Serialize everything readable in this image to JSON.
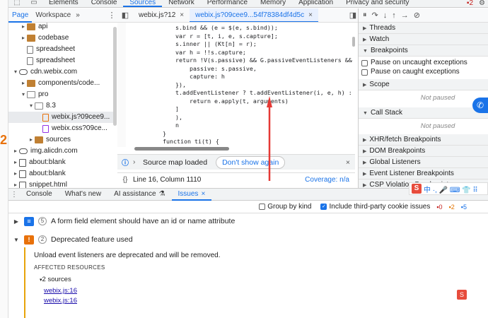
{
  "main_tabs": [
    "Elements",
    "Console",
    "Sources",
    "Network",
    "Performance",
    "Memory",
    "Application",
    "Privacy and security"
  ],
  "main_tabs_active": "Sources",
  "badge_count": "2",
  "navigator": {
    "tabs": [
      "Page",
      "Workspace"
    ],
    "more": "»",
    "items": [
      {
        "label": "api",
        "type": "folder",
        "depth": 2,
        "caret": "▸"
      },
      {
        "label": "codebase",
        "type": "folder",
        "depth": 2,
        "caret": "▸"
      },
      {
        "label": "spreadsheet",
        "type": "file",
        "depth": 2,
        "caret": ""
      },
      {
        "label": "spreadsheet",
        "type": "file",
        "depth": 2,
        "caret": ""
      },
      {
        "label": "cdn.webix.com",
        "type": "cloud",
        "depth": 1,
        "caret": "▾"
      },
      {
        "label": "components/code...",
        "type": "folder",
        "depth": 2,
        "caret": "▸"
      },
      {
        "label": "pro",
        "type": "folder-open",
        "depth": 2,
        "caret": "▾"
      },
      {
        "label": "8.3",
        "type": "folder-open",
        "depth": 3,
        "caret": "▾"
      },
      {
        "label": "webix.js?09cee9...",
        "type": "js",
        "depth": 4,
        "caret": ""
      },
      {
        "label": "webix.css?09ce...",
        "type": "css",
        "depth": 4,
        "caret": ""
      },
      {
        "label": "sources",
        "type": "folder",
        "depth": 3,
        "caret": "▸"
      },
      {
        "label": "img.alicdn.com",
        "type": "cloud",
        "depth": 1,
        "caret": "▸"
      },
      {
        "label": "about:blank",
        "type": "doc",
        "depth": 1,
        "caret": "▸"
      },
      {
        "label": "about:blank",
        "type": "doc",
        "depth": 1,
        "caret": "▸"
      },
      {
        "label": "snippet.html",
        "type": "doc",
        "depth": 1,
        "caret": "▸"
      }
    ]
  },
  "editor": {
    "tabs": [
      {
        "label": "webix.js?12",
        "close": "×",
        "active": false
      },
      {
        "label": "webix.js?09cee9...54f78384df4d5c",
        "close": "×",
        "active": true
      }
    ],
    "code": [
      {
        "text": "s.bind && (e = $(e, s.bind));",
        "indent": 82,
        "kw": false
      },
      {
        "text": "var r = [t, i, e, s.capture];",
        "indent": 82,
        "kw": true
      },
      {
        "text": "s.inner || (Kt[n] = r);",
        "indent": 82,
        "kw": false
      },
      {
        "text": "var h = !!s.capture;",
        "indent": 82,
        "kw": true
      },
      {
        "text": "return !V(s.passive) && G.passiveEventListeners && (h =",
        "indent": 82,
        "kw": true
      },
      {
        "text": "    passive: s.passive,",
        "indent": 82,
        "kw": false
      },
      {
        "text": "    capture: h",
        "indent": 82,
        "kw": false
      },
      {
        "text": "}),",
        "indent": 82,
        "kw": false
      },
      {
        "text": "t.addEventListener ? t.addEventListener(i, e, h) : t.a",
        "indent": 82,
        "kw": false
      },
      {
        "text": "    return e.apply(t, arguments)",
        "indent": 82,
        "kw": true
      },
      {
        "text": "]",
        "indent": 82,
        "kw": false
      },
      {
        "text": "),",
        "indent": 82,
        "kw": false
      },
      {
        "text": "n",
        "indent": 82,
        "kw": false
      },
      {
        "text": "}",
        "indent": 64,
        "kw": false
      },
      {
        "text": "function ti(t) {",
        "indent": 64,
        "kw": true
      }
    ],
    "sourcemap_msg": "Source map loaded",
    "dont_show": "Don't show again",
    "status_pos": "Line 16, Column 1110",
    "coverage": "Coverage: n/a"
  },
  "debugger": {
    "sections": [
      {
        "label": "Threads",
        "open": false
      },
      {
        "label": "Watch",
        "open": false
      },
      {
        "label": "Breakpoints",
        "open": true
      }
    ],
    "bp_options": [
      "Pause on uncaught exceptions",
      "Pause on caught exceptions"
    ],
    "scope": "Scope",
    "not_paused": "Not paused",
    "call_stack": "Call Stack",
    "more_sections": [
      "XHR/fetch Breakpoints",
      "DOM Breakpoints",
      "Global Listeners",
      "Event Listener Breakpoints",
      "CSP Violation Breakpoints"
    ]
  },
  "drawer": {
    "tabs": [
      {
        "label": "Console",
        "close": ""
      },
      {
        "label": "What's new",
        "close": ""
      },
      {
        "label": "AI assistance",
        "close": "⚗"
      },
      {
        "label": "Issues",
        "close": "×"
      }
    ],
    "active": "Issues",
    "group_by_kind": "Group by kind",
    "include_third_party": "Include third-party cookie issues",
    "counts": [
      "0",
      "2",
      "5"
    ]
  },
  "issues": [
    {
      "count": "5",
      "title": "A form field element should have an id or name attribute",
      "kind": "info"
    },
    {
      "count": "2",
      "title": "Deprecated feature used",
      "kind": "warn"
    }
  ],
  "issue_detail": {
    "message": "Unload event listeners are deprecated and will be removed.",
    "affected": "AFFECTED RESOURCES",
    "sources_label": "2 sources",
    "links": [
      "webix.js:16",
      "webix.js:16"
    ]
  },
  "ime_letter": "S",
  "ime_symbols": "中 ·, 🎤 ⌨ 👕 ⠿"
}
